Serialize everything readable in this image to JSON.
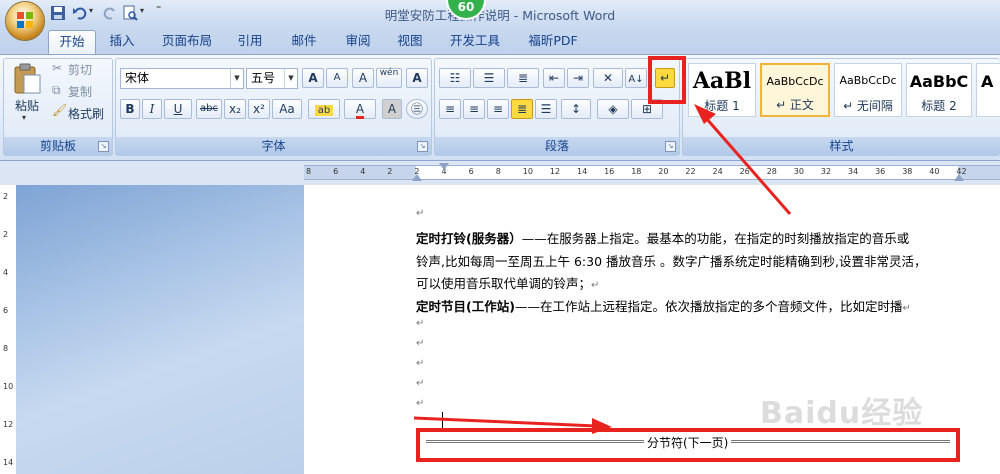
{
  "window": {
    "title": "明堂安防工程操作说明 - Microsoft Word",
    "badge": "60"
  },
  "tabs": [
    {
      "label": "开始",
      "active": true
    },
    {
      "label": "插入"
    },
    {
      "label": "页面布局"
    },
    {
      "label": "引用"
    },
    {
      "label": "邮件"
    },
    {
      "label": "审阅"
    },
    {
      "label": "视图"
    },
    {
      "label": "开发工具"
    },
    {
      "label": "福昕PDF"
    }
  ],
  "clipboard": {
    "paste": "粘贴",
    "cut": "剪切",
    "copy": "复制",
    "format_painter": "格式刷",
    "group_label": "剪贴板"
  },
  "font": {
    "family": "宋体",
    "size": "五号",
    "group_label": "字体",
    "bold": "B",
    "italic": "I",
    "underline": "U",
    "strike": "abc",
    "subscript": "x₂",
    "superscript": "x²",
    "change_case": "Aa",
    "grow": "A",
    "shrink": "A",
    "phonetic": "wén",
    "border_char": "A"
  },
  "paragraph": {
    "group_label": "段落"
  },
  "styles": {
    "group_label": "样式",
    "items": [
      {
        "sample": "AaBl",
        "name": "标题 1"
      },
      {
        "sample": "AaBbCcDc",
        "name": "↵ 正文"
      },
      {
        "sample": "AaBbCcDc",
        "name": "↵ 无间隔"
      },
      {
        "sample": "AaBbC",
        "name": "标题 2"
      }
    ]
  },
  "ruler": {
    "h_numbers": [
      "8",
      "6",
      "4",
      "2",
      "2",
      "4",
      "6",
      "8",
      "10",
      "12",
      "14",
      "16",
      "18",
      "20",
      "22",
      "24",
      "26",
      "28",
      "30",
      "32",
      "34",
      "36",
      "38",
      "40",
      "42"
    ],
    "v_numbers": [
      "2",
      "2",
      "4",
      "6",
      "8",
      "10",
      "12",
      "14"
    ]
  },
  "document": {
    "p1_bold": "定时打铃(服务器）",
    "p1_rest": "——在服务器上指定。最基本的功能，在指定的时刻播放指定的音乐或",
    "p1_line2": "铃声,比如每周一至周五上午 6:30 播放音乐 。数字广播系统定时能精确到秒,设置非常灵活，",
    "p1_line3": "可以使用音乐取代单调的铃声；",
    "p2_bold": "定时节目(工作站)",
    "p2_rest": "——在工作站上远程指定。依次播放指定的多个音频文件，比如定时播",
    "section_break": "分节符(下一页)",
    "para_mark": "↵"
  },
  "colors": {
    "annotation": "#e8231f",
    "highlight": "#ffd940"
  },
  "watermark": "Baidu经验"
}
